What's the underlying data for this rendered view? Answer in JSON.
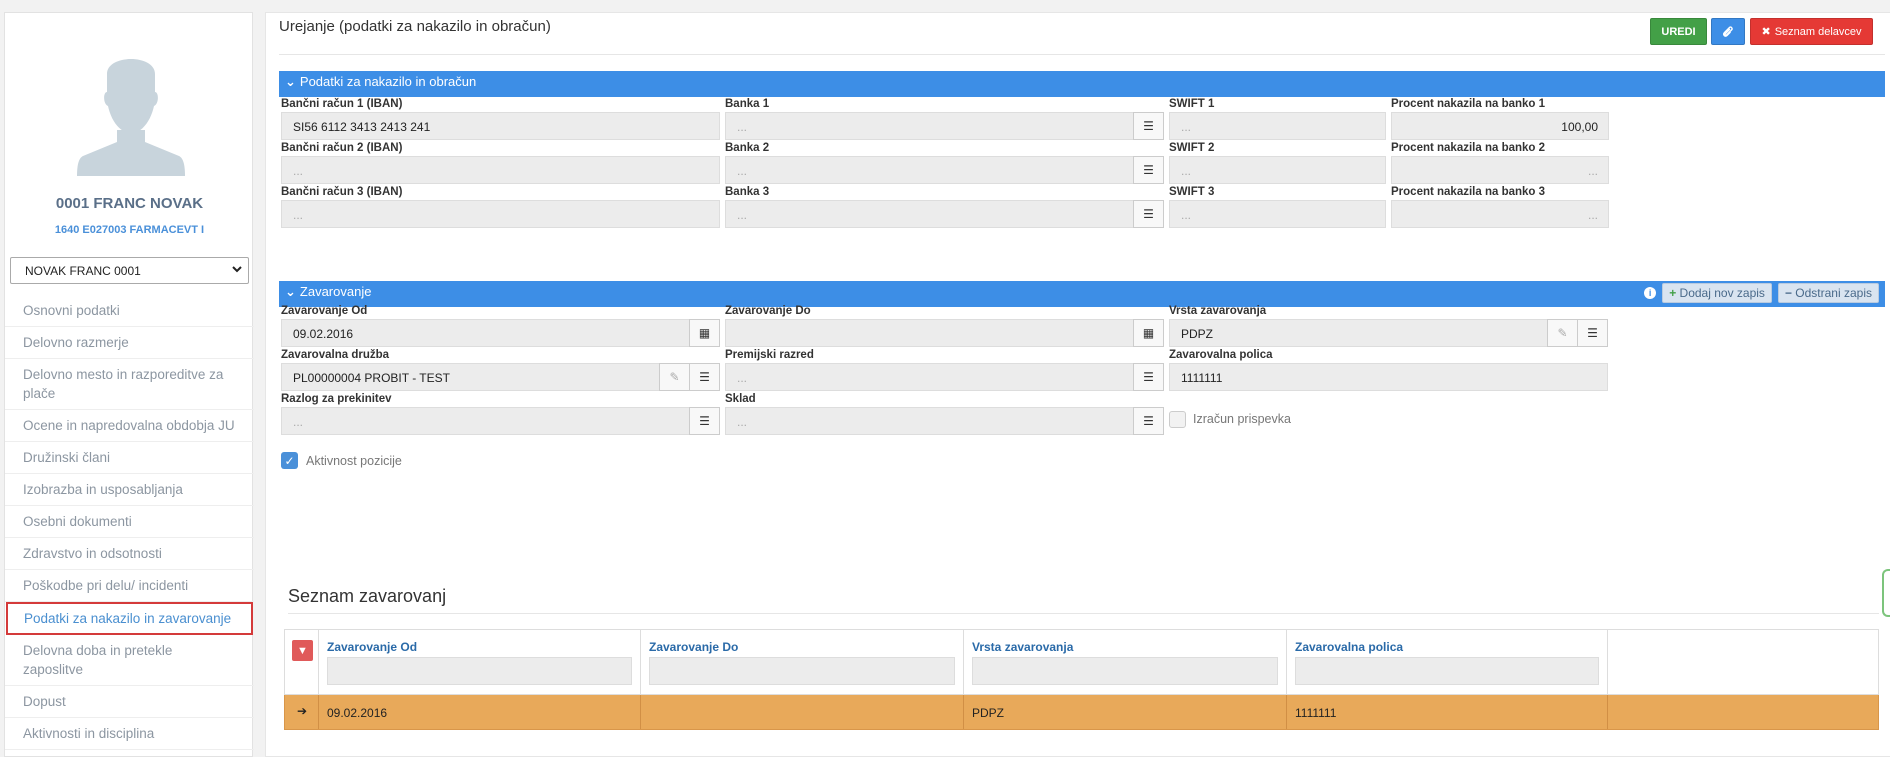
{
  "employee": {
    "name": "0001 FRANC NOVAK",
    "subtitle": "1640 E027003 FARMACEVT I",
    "select_value": "NOVAK FRANC 0001"
  },
  "nav": [
    "Osnovni podatki",
    "Delovno razmerje",
    "Delovno mesto in razporeditve za plače",
    "Ocene in napredovalna obdobja JU",
    "Družinski člani",
    "Izobrazba in usposabljanja",
    "Osebni dokumenti",
    "Zdravstvo in odsotnosti",
    "Poškodbe pri delu/ incidenti",
    "Podatki za nakazilo in zavarovanje",
    "Delovna doba in pretekle zaposlitve",
    "Dopust",
    "Aktivnosti in disciplina"
  ],
  "nav_active_index": 9,
  "header": {
    "title": "Urejanje (podatki za nakazilo in obračun)",
    "uredi_label": "UREDI",
    "seznam_label": "Seznam delavcev"
  },
  "payment": {
    "section_title": "Podatki za nakazilo in obračun",
    "rows": [
      {
        "iban_label": "Bančni račun 1 (IBAN)",
        "iban": "SI56 6112 3413 2413 241",
        "bank_label": "Banka 1",
        "bank": "...",
        "swift_label": "SWIFT 1",
        "swift": "...",
        "pct_label": "Procent nakazila na banko 1",
        "pct": "100,00"
      },
      {
        "iban_label": "Bančni račun 2 (IBAN)",
        "iban": "...",
        "bank_label": "Banka 2",
        "bank": "...",
        "swift_label": "SWIFT 2",
        "swift": "...",
        "pct_label": "Procent nakazila na banko 2",
        "pct": "..."
      },
      {
        "iban_label": "Bančni račun 3 (IBAN)",
        "iban": "...",
        "bank_label": "Banka 3",
        "bank": "...",
        "swift_label": "SWIFT 3",
        "swift": "...",
        "pct_label": "Procent nakazila na banko 3",
        "pct": "..."
      }
    ]
  },
  "insurance": {
    "section_title": "Zavarovanje",
    "add_label": "Dodaj nov zapis",
    "remove_label": "Odstrani zapis",
    "od_label": "Zavarovanje Od",
    "od_value": "09.02.2016",
    "do_label": "Zavarovanje Do",
    "do_value": "",
    "vrsta_label": "Vrsta zavarovanja",
    "vrsta_value": "PDPZ",
    "druzba_label": "Zavarovalna družba",
    "druzba_value": "PL00000004 PROBIT - TEST",
    "razred_label": "Premijski razred",
    "razred_value": "...",
    "polica_label": "Zavarovalna polica",
    "polica_value": "1111111",
    "razlog_label": "Razlog za prekinitev",
    "razlog_value": "...",
    "sklad_label": "Sklad",
    "sklad_value": "...",
    "izracun_label": "Izračun prispevka",
    "aktivnost_label": "Aktivnost pozicije"
  },
  "list": {
    "title": "Seznam zavarovanj",
    "columns": [
      "Zavarovanje Od",
      "Zavarovanje Do",
      "Vrsta zavarovanja",
      "Zavarovalna polica"
    ],
    "rows": [
      [
        "09.02.2016",
        "",
        "PDPZ",
        "1111111"
      ]
    ]
  },
  "colors": {
    "primary": "#3d8ee6",
    "success": "#43a047",
    "danger": "#e53935",
    "row_highlight": "#e8a95a"
  }
}
